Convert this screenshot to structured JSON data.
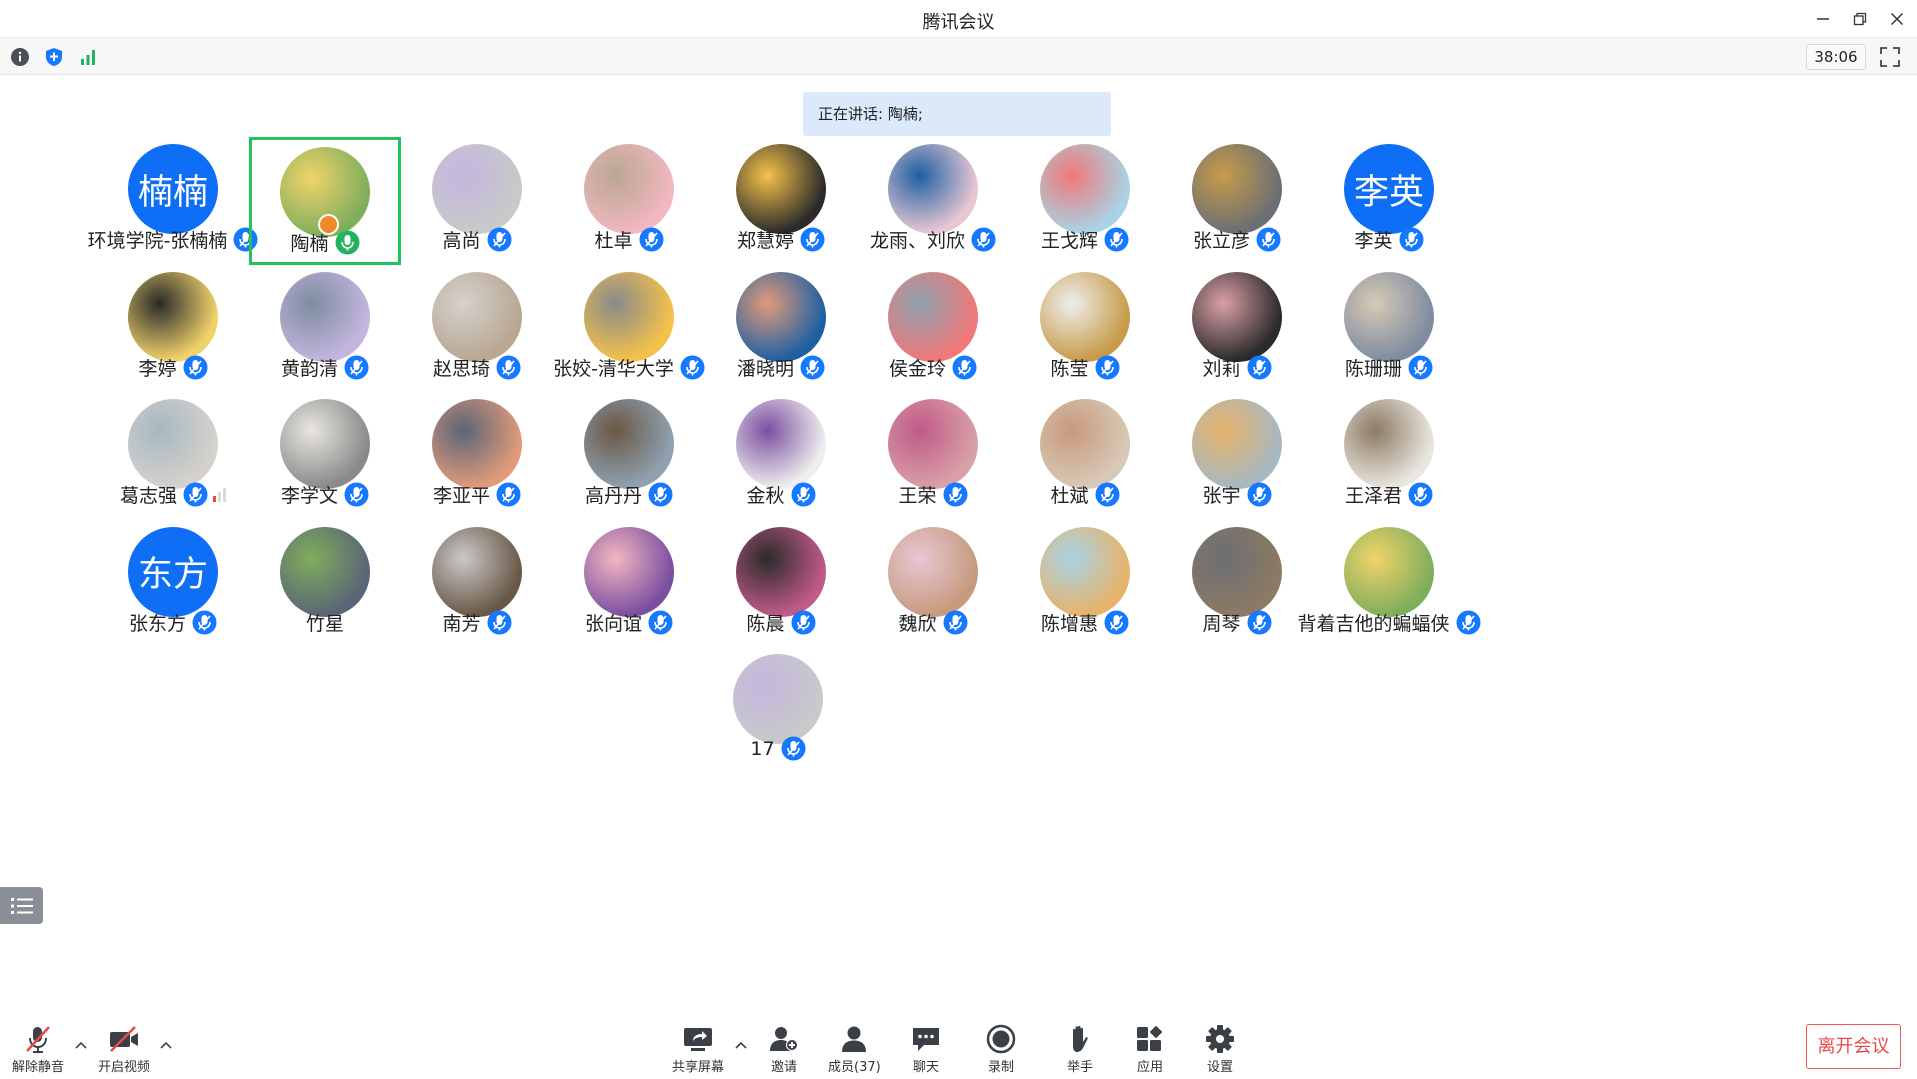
{
  "window": {
    "title": "腾讯会议"
  },
  "infobar": {
    "timer": "38:06"
  },
  "speaking": {
    "text": "正在讲话: 陶楠;"
  },
  "colors": {
    "accent": "#0e6ef5",
    "selected_border": "#22c35e",
    "leave_red": "#e84a4a",
    "banner_bg": "#dbe9fb"
  },
  "participants": [
    {
      "name": "环境学院-张楠楠",
      "avatar_text": "楠楠"
    },
    {
      "name": "陶楠",
      "speaking": true,
      "host": true
    },
    {
      "name": "高尚"
    },
    {
      "name": "杜卓"
    },
    {
      "name": "郑慧婷"
    },
    {
      "name": "龙雨、刘欣"
    },
    {
      "name": "王戈辉"
    },
    {
      "name": "张立彦"
    },
    {
      "name": "李英",
      "avatar_text": "李英"
    },
    {
      "name": "李婷"
    },
    {
      "name": "黄韵清"
    },
    {
      "name": "赵思琦"
    },
    {
      "name": "张姣-清华大学"
    },
    {
      "name": "潘晓明"
    },
    {
      "name": "侯金玲"
    },
    {
      "name": "陈莹"
    },
    {
      "name": "刘莉"
    },
    {
      "name": "陈珊珊"
    },
    {
      "name": "葛志强",
      "signal": "weak"
    },
    {
      "name": "李学文"
    },
    {
      "name": "李亚平"
    },
    {
      "name": "高丹丹"
    },
    {
      "name": "金秋"
    },
    {
      "name": "王荣"
    },
    {
      "name": "杜斌"
    },
    {
      "name": "张宇"
    },
    {
      "name": "王泽君"
    },
    {
      "name": "张东方",
      "avatar_text": "东方"
    },
    {
      "name": "竹星",
      "no_mic": true
    },
    {
      "name": "南芳"
    },
    {
      "name": "张向谊"
    },
    {
      "name": "陈晨"
    },
    {
      "name": "魏欣"
    },
    {
      "name": "陈增惠"
    },
    {
      "name": "周琴"
    },
    {
      "name": "背着吉他的蝙蝠侠"
    },
    {
      "name": "17"
    }
  ],
  "toolbar": {
    "unmute": "解除静音",
    "video": "开启视频",
    "share": "共享屏幕",
    "invite": "邀请",
    "members": "成员(37)",
    "chat": "聊天",
    "record": "录制",
    "raise_hand": "举手",
    "apps": "应用",
    "settings": "设置",
    "leave": "离开会议"
  }
}
